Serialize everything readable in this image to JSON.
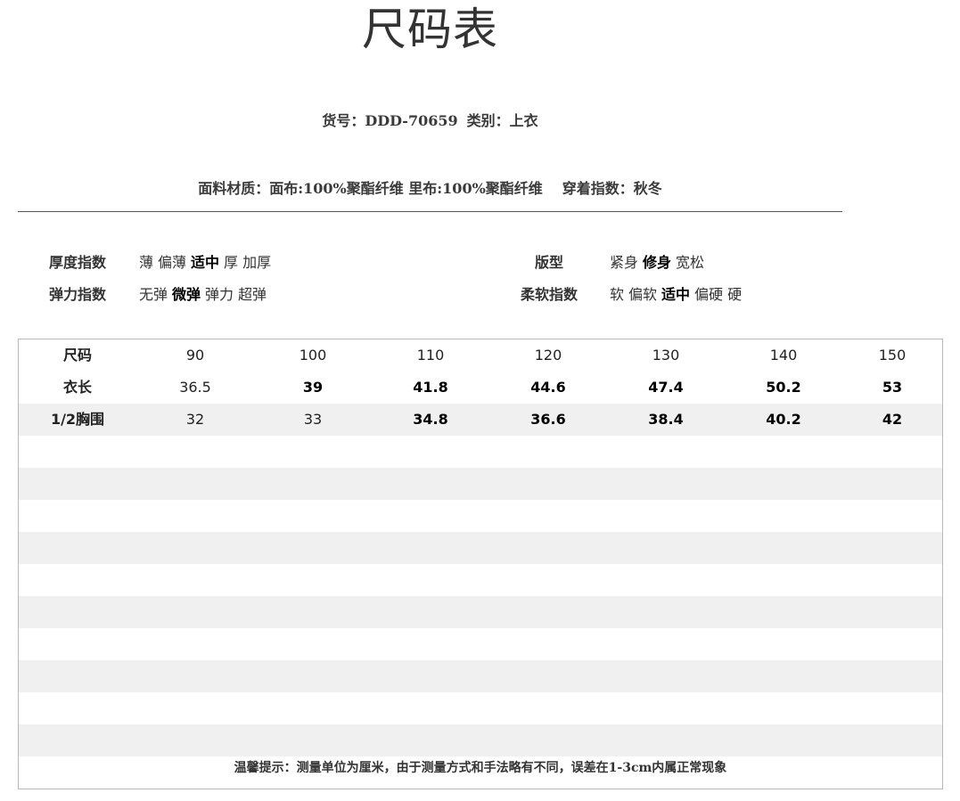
{
  "title": "尺码表",
  "info": {
    "product_code": "货号：DDD-70659",
    "category": "类别：上衣",
    "fabric": "面料材质：面布:100%聚酯纤维 里布:100%聚酯纤维",
    "season": "穿着指数：秋冬"
  },
  "properties": [
    {
      "label": "厚度指数",
      "options": [
        "薄",
        "偏薄",
        "适中",
        "厚",
        "加厚"
      ],
      "selected": "适中"
    },
    {
      "label": "版型",
      "options": [
        "紧身",
        "修身",
        "宽松"
      ],
      "selected": "修身"
    },
    {
      "label": "弹力指数",
      "options": [
        "无弹",
        "微弹",
        "弹力",
        "超弹"
      ],
      "selected": "微弹"
    },
    {
      "label": "柔软指数",
      "options": [
        "软",
        "偏软",
        "适中",
        "偏硬",
        "硬"
      ],
      "selected": "适中"
    }
  ],
  "size_table": {
    "rows": [
      {
        "label": "尺码",
        "values": [
          "90",
          "100",
          "110",
          "120",
          "130",
          "140",
          "150"
        ]
      },
      {
        "label": "衣长",
        "values": [
          "36.5",
          "39",
          "41.8",
          "44.6",
          "47.4",
          "50.2",
          "53"
        ]
      },
      {
        "label": "1/2胸围",
        "values": [
          "32",
          "33",
          "34.8",
          "36.6",
          "38.4",
          "40.2",
          "42"
        ]
      }
    ]
  },
  "footer_note": "温馨提示：测量单位为厘米，由于测量方式和手法略有不同，误差在1-3cm内属正常现象",
  "colors": {
    "text": "#333333",
    "stripe": "#f0f0f0",
    "border": "#b8b8b8",
    "rule": "#555555"
  }
}
